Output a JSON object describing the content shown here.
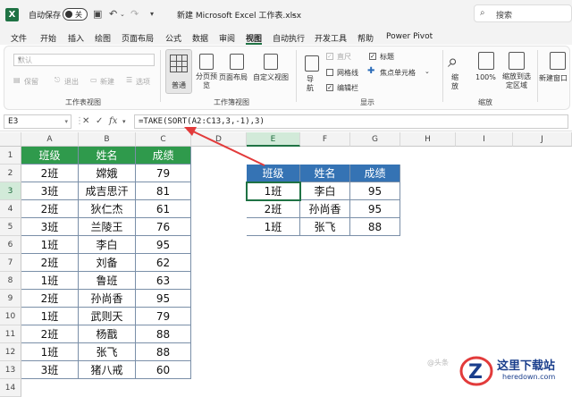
{
  "titlebar": {
    "autosave_label": "自动保存",
    "autosave_state": "关",
    "document_title": "新建 Microsoft Excel 工作表.xlsx",
    "search_placeholder": "搜索"
  },
  "menu": {
    "items": [
      "文件",
      "开始",
      "插入",
      "绘图",
      "页面布局",
      "公式",
      "数据",
      "审阅",
      "视图",
      "自动执行",
      "开发工具",
      "帮助",
      "Power Pivot"
    ],
    "active": "视图"
  },
  "ribbon": {
    "sheet_view_combo": "默认",
    "sheet_view_buttons": [
      "保留",
      "退出",
      "新建",
      "选项"
    ],
    "group_sheet_view": "工作表视图",
    "workbook_view_buttons": [
      "普通",
      "分页预览",
      "页面布局",
      "自定义视图"
    ],
    "group_workbook_view": "工作簿视图",
    "show_items": [
      {
        "label": "直尺",
        "checked": true,
        "enabled": false
      },
      {
        "label": "标题",
        "checked": true,
        "enabled": true
      },
      {
        "label": "网格线",
        "checked": false,
        "enabled": true
      },
      {
        "label": "编辑栏",
        "checked": true,
        "enabled": true
      }
    ],
    "navigation_label": "导航",
    "focus_cell_label": "焦点单元格",
    "group_show": "显示",
    "zoom_buttons": [
      "缩放",
      "100%",
      "缩放到选定区域"
    ],
    "group_zoom": "缩放",
    "new_window_label": "新建窗口"
  },
  "formula_bar": {
    "name_box": "E3",
    "formula": "=TAKE(SORT(A2:C13,3,-1),3)"
  },
  "sheet": {
    "columns": [
      "A",
      "B",
      "C",
      "D",
      "E",
      "F",
      "G",
      "H",
      "I",
      "J"
    ],
    "rows": [
      "1",
      "2",
      "3",
      "4",
      "5",
      "6",
      "7",
      "8",
      "9",
      "10",
      "11",
      "12",
      "13",
      "14"
    ],
    "selected_cell": "E3",
    "source_table": {
      "headers": [
        "班级",
        "姓名",
        "成绩"
      ],
      "rows": [
        [
          "2班",
          "嫦娥",
          "79"
        ],
        [
          "3班",
          "成吉思汗",
          "81"
        ],
        [
          "2班",
          "狄仁杰",
          "61"
        ],
        [
          "3班",
          "兰陵王",
          "76"
        ],
        [
          "1班",
          "李白",
          "95"
        ],
        [
          "2班",
          "刘备",
          "62"
        ],
        [
          "1班",
          "鲁班",
          "63"
        ],
        [
          "2班",
          "孙尚香",
          "95"
        ],
        [
          "1班",
          "武则天",
          "79"
        ],
        [
          "2班",
          "杨戬",
          "88"
        ],
        [
          "1班",
          "张飞",
          "88"
        ],
        [
          "3班",
          "猪八戒",
          "60"
        ]
      ],
      "header_color": "#2f9a4c"
    },
    "result_table": {
      "headers": [
        "班级",
        "姓名",
        "成绩"
      ],
      "rows": [
        [
          "1班",
          "李白",
          "95"
        ],
        [
          "2班",
          "孙尚香",
          "95"
        ],
        [
          "1班",
          "张飞",
          "88"
        ]
      ],
      "header_color": "#3573b4"
    }
  },
  "watermark": {
    "handle": "@头条",
    "brand": "这里下载站",
    "url": "heredown.com"
  }
}
